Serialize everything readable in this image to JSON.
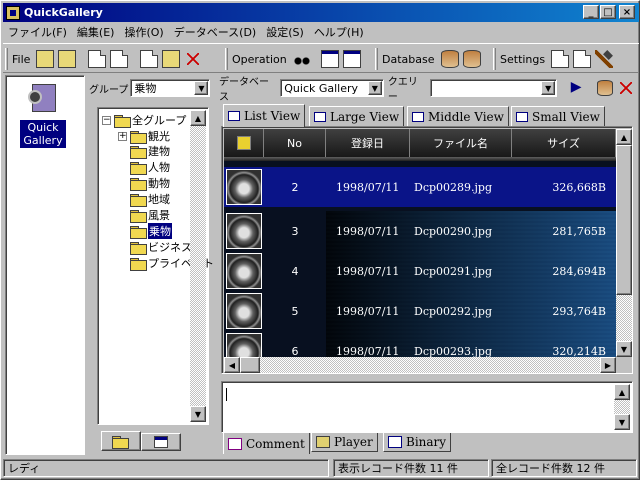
{
  "window": {
    "title": "QuickGallery"
  },
  "menu": [
    "ファイル(F)",
    "編集(E)",
    "操作(O)",
    "データベース(D)",
    "設定(S)",
    "ヘルプ(H)"
  ],
  "toolbar": {
    "file_label": "File",
    "operation_label": "Operation",
    "database_label": "Database",
    "settings_label": "Settings"
  },
  "left": {
    "app_label_line1": "Quick",
    "app_label_line2": "Gallery"
  },
  "group": {
    "label": "グループ",
    "value": "乗物"
  },
  "tree": {
    "root": "全グループ",
    "items": [
      "観光",
      "建物",
      "人物",
      "動物",
      "地域",
      "風景",
      "乗物",
      "ビジネス",
      "プライベート"
    ],
    "selected": "乗物"
  },
  "dbbar": {
    "db_label": "データベース",
    "db_value": "Quick Gallery",
    "query_label": "クエリー",
    "query_value": ""
  },
  "viewtabs": [
    "List View",
    "Large View",
    "Middle View",
    "Small View"
  ],
  "list": {
    "columns": [
      "No",
      "登録日",
      "ファイル名",
      "サイズ"
    ],
    "rows": [
      {
        "no": "2",
        "date": "1998/07/11",
        "file": "Dcp00289.jpg",
        "size": "326,668B"
      },
      {
        "no": "3",
        "date": "1998/07/11",
        "file": "Dcp00290.jpg",
        "size": "281,765B"
      },
      {
        "no": "4",
        "date": "1998/07/11",
        "file": "Dcp00291.jpg",
        "size": "284,694B"
      },
      {
        "no": "5",
        "date": "1998/07/11",
        "file": "Dcp00292.jpg",
        "size": "293,764B"
      },
      {
        "no": "6",
        "date": "1998/07/11",
        "file": "Dcp00293.jpg",
        "size": "320,214B"
      }
    ]
  },
  "bottomtabs": [
    "Comment",
    "Player",
    "Binary"
  ],
  "status": {
    "ready": "レディ",
    "shown": "表示レコード件数  11 件",
    "total": "全レコード件数  12 件"
  }
}
